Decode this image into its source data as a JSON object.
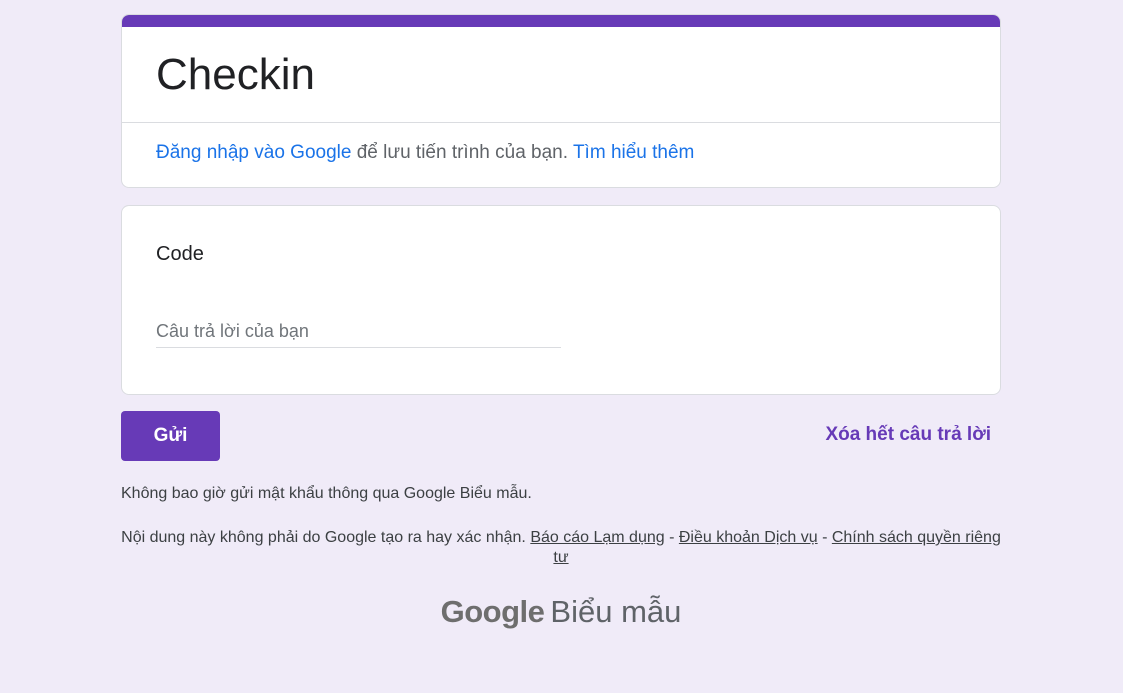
{
  "form": {
    "title": "Checkin",
    "signin": {
      "link_text": "Đăng nhập vào Google",
      "middle_text": " để lưu tiến trình của bạn. ",
      "learn_more": "Tìm hiểu thêm"
    }
  },
  "question": {
    "title": "Code",
    "placeholder": "Câu trả lời của bạn",
    "value": ""
  },
  "actions": {
    "submit_label": "Gửi",
    "clear_label": "Xóa hết câu trả lời"
  },
  "footer": {
    "password_note": "Không bao giờ gửi mật khẩu thông qua Google Biểu mẫu.",
    "disclaimer_text": "Nội dung này không phải do Google tạo ra hay xác nhận. ",
    "report_abuse": "Báo cáo Lạm dụng",
    "separator1": " - ",
    "terms": "Điều khoản Dịch vụ",
    "separator2": " - ",
    "privacy": "Chính sách quyền riêng tư",
    "brand_google": "Google",
    "brand_forms": "Biểu mẫu"
  },
  "colors": {
    "accent": "#673ab7",
    "background": "#f0ebf8",
    "link": "#1a73e8"
  }
}
